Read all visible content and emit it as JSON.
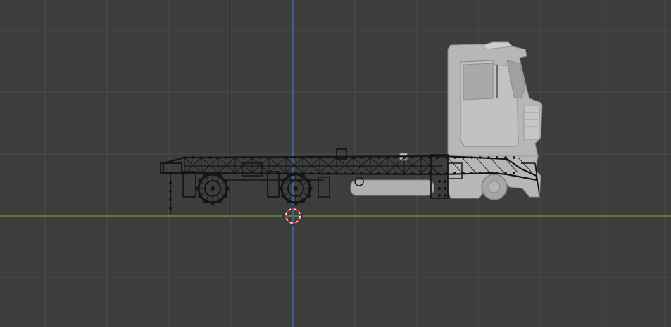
{
  "viewport": {
    "view": "side-orthographic",
    "background_color": "#3d3d3d",
    "grid_color": "#4a4a4a",
    "x_axis_color": "#6f8f2f",
    "z_axis_color": "#3f6aa8",
    "icons": {
      "cursor": "3d-cursor-icon",
      "origin": "object-origin-icon"
    }
  },
  "scene": {
    "objects": [
      {
        "name": "truck-cab",
        "color": "#b9b9b9",
        "display": "solid"
      },
      {
        "name": "truck-chassis",
        "color": "#1a1a1a",
        "display": "wireframe",
        "selected": false
      },
      {
        "name": "front-wheel",
        "color": "#a6a6a6",
        "display": "solid"
      },
      {
        "name": "rear-wheel-1",
        "color": "#1a1a1a",
        "display": "wireframe"
      },
      {
        "name": "rear-wheel-2",
        "color": "#1a1a1a",
        "display": "wireframe"
      }
    ]
  }
}
